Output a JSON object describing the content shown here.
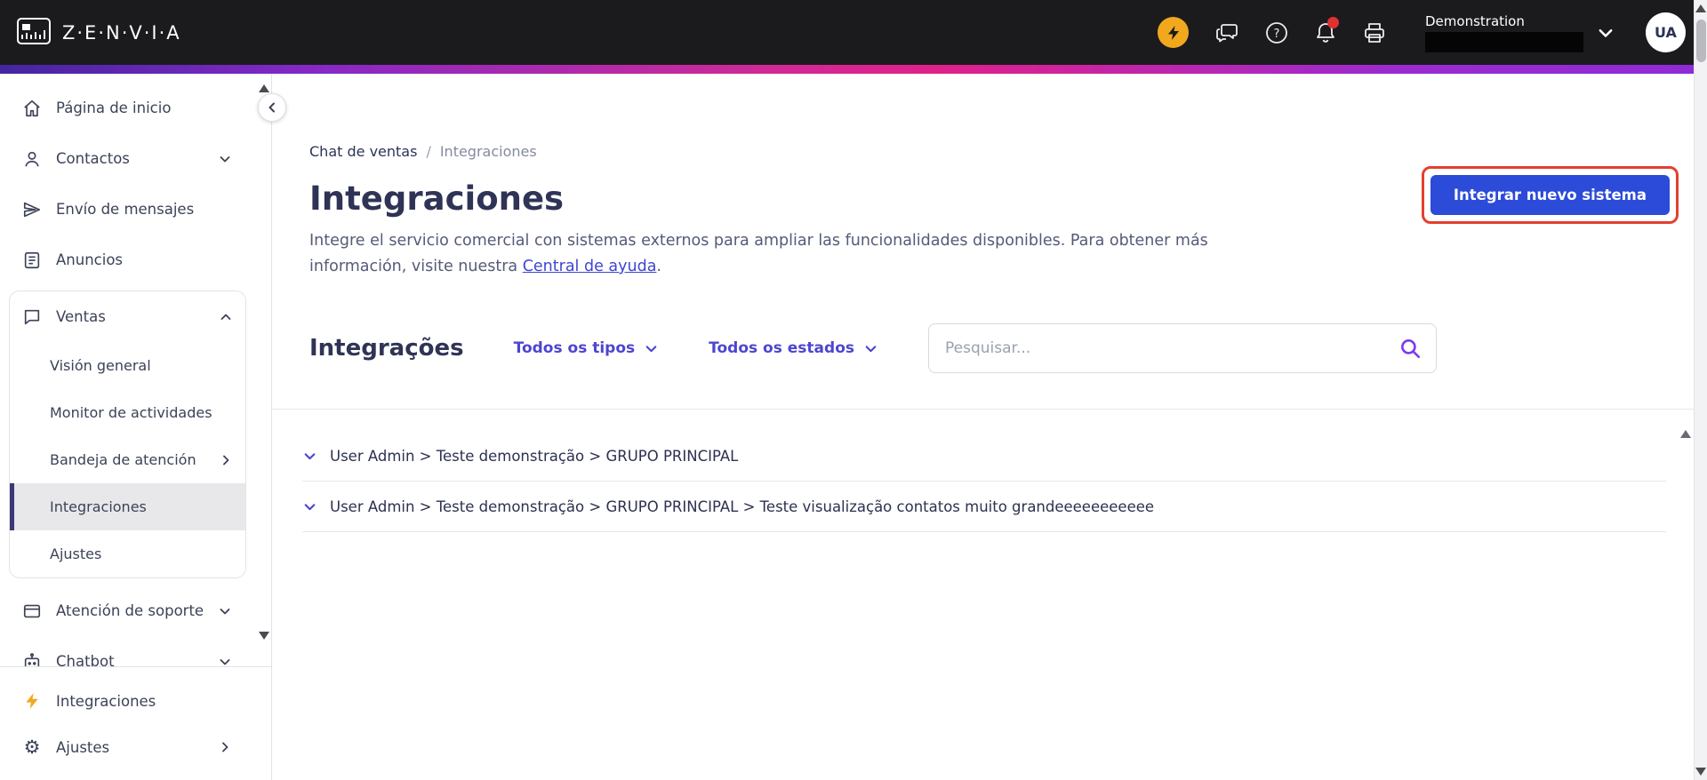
{
  "topbar": {
    "brand": "Z·E·N·V·I·A",
    "workspace": "Demonstration",
    "avatar_initials": "UA",
    "icons": [
      "zenvia-logo-icon",
      "lightning-icon",
      "conversations-icon",
      "help-icon",
      "notifications-icon",
      "printer-icon",
      "chevron-down-icon"
    ]
  },
  "sidebar": {
    "items": {
      "home": "Página de inicio",
      "contacts": "Contactos",
      "messaging": "Envío de mensajes",
      "announcements": "Anuncios",
      "sales": "Ventas",
      "support": "Atención de soporte",
      "chatbot": "Chatbot"
    },
    "sales_submenu": [
      "Visión general",
      "Monitor de actividades",
      "Bandeja de atención",
      "Integraciones",
      "Ajustes"
    ],
    "bottom": {
      "integrations": "Integraciones",
      "settings": "Ajustes"
    }
  },
  "main": {
    "breadcrumb": {
      "parent": "Chat de ventas",
      "separator": "/",
      "current": "Integraciones"
    },
    "title": "Integraciones",
    "description_before_link": "Integre el servicio comercial con sistemas externos para ampliar las funcionalidades disponibles. Para obtener más información, visite nuestra ",
    "help_link": "Central de ayuda",
    "description_after_link": ".",
    "new_integration_button": "Integrar nuevo sistema",
    "list": {
      "title": "Integrações",
      "type_filter": "Todos os tipos",
      "status_filter": "Todos os estados",
      "search_placeholder": "Pesquisar...",
      "rows": [
        {
          "label": "User Admin > Teste demonstração > GRUPO PRINCIPAL"
        },
        {
          "label": "User Admin > Teste demonstração > GRUPO PRINCIPAL > Teste visualização contatos muito grandeeeeeeeeeee"
        }
      ]
    }
  },
  "colors": {
    "topbar_bg": "#1b1b1d",
    "accent_purple": "#7c3aed",
    "filter_indigo": "#4d45cf",
    "button_blue": "#2c4bd8",
    "annotation_red": "#e3402f",
    "notification_red": "#e03131",
    "lightning_yellow": "#f2a81d",
    "gradient": [
      "#44269f",
      "#d02a96",
      "#8e2bd6"
    ]
  }
}
